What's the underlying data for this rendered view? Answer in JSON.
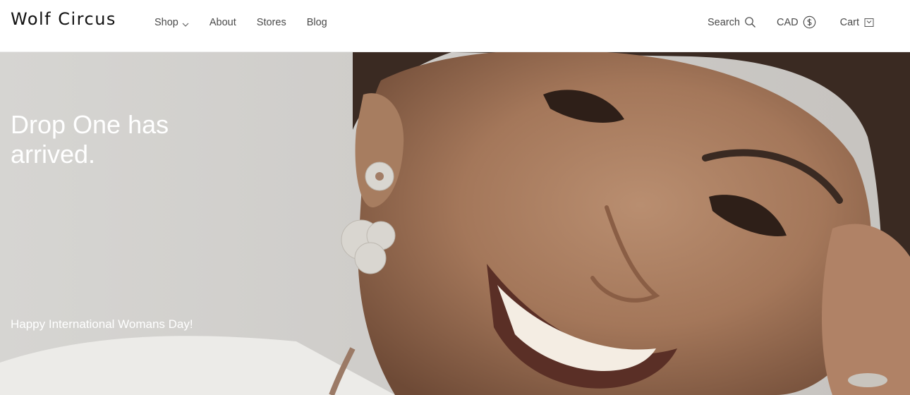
{
  "header": {
    "logo": "Wolf Circus",
    "nav": [
      {
        "label": "Shop",
        "has_dropdown": true
      },
      {
        "label": "About"
      },
      {
        "label": "Stores"
      },
      {
        "label": "Blog"
      }
    ],
    "search_label": "Search",
    "currency_label": "CAD",
    "cart_label": "Cart"
  },
  "hero": {
    "title": "Drop One has arrived.",
    "subtitle": "Happy International Womans Day!"
  },
  "colors": {
    "text": "#4a4a4a",
    "logo": "#111111",
    "hero_text": "#ffffff"
  },
  "icons": [
    "chevron-down-icon",
    "search-icon",
    "dollar-circle-icon",
    "cart-icon"
  ]
}
